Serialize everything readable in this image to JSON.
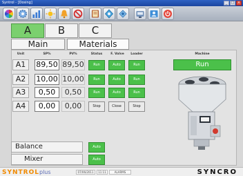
{
  "window": {
    "title": "Syntrol - [Dosing]"
  },
  "toolbar": {
    "icons": [
      "color-wheel-icon",
      "gear-icon",
      "chart-icon",
      "sun-icon",
      "alarm-bell-icon",
      "stop-sign-icon",
      "book-icon",
      "pump-icon",
      "network-icon",
      "machine-icon",
      "user-icon",
      "power-icon"
    ]
  },
  "tabs": {
    "top": [
      "A",
      "B",
      "C"
    ],
    "active_top": "A",
    "sub": [
      "Main",
      "Materials"
    ]
  },
  "headers": {
    "unit": "Unit",
    "sp": "SP%",
    "pv": "PV%",
    "status": "Status",
    "fvalve": "F. Valve",
    "loader": "Loader",
    "machine": "Machine"
  },
  "rows": [
    {
      "unit": "A1",
      "sp": "89,50",
      "pv": "89,50",
      "status": "Run",
      "fvalve": "Auto",
      "loader": "Run",
      "active": true
    },
    {
      "unit": "A2",
      "sp": "10,00",
      "pv": "10,00",
      "status": "Run",
      "fvalve": "Auto",
      "loader": "Run",
      "active": true
    },
    {
      "unit": "A3",
      "sp": "0,50",
      "pv": "0,50",
      "status": "Run",
      "fvalve": "Auto",
      "loader": "Run",
      "active": true
    },
    {
      "unit": "A4",
      "sp": "0,00",
      "pv": "0,00",
      "status": "Stop",
      "fvalve": "Close",
      "loader": "Stop",
      "active": false
    }
  ],
  "machine": {
    "status": "Run"
  },
  "bottom": {
    "balance_label": "Balance",
    "balance_value": "Auto",
    "mixer_label": "Mixer",
    "mixer_value": "Auto"
  },
  "footer": {
    "brand_left": "SYNTROL",
    "brand_left_suffix": "plus",
    "date": "07/06/2011",
    "time": "11:11",
    "mode": "ALARMS",
    "brand_right": "SYNCRO"
  },
  "colors": {
    "active_green": "#4bc04a",
    "tab_green": "#7bd06e",
    "brand_orange": "#f08a00"
  }
}
